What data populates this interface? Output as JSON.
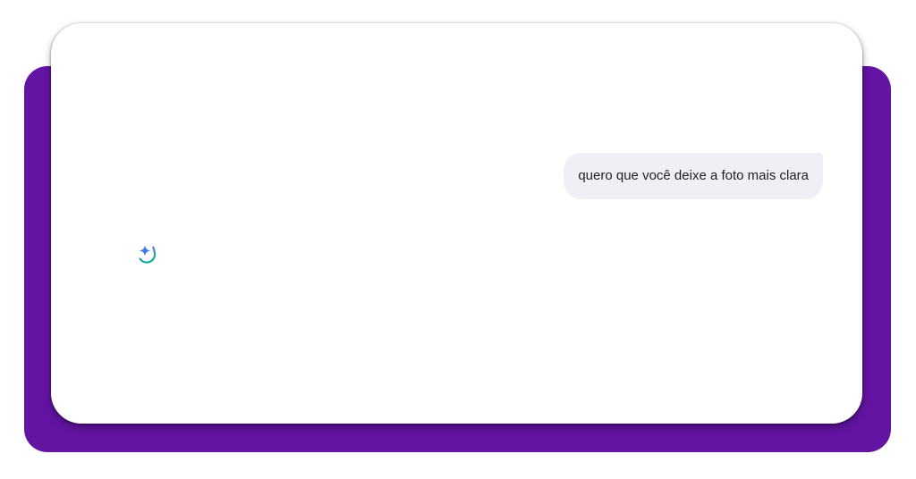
{
  "colors": {
    "backdrop": "#6314a3",
    "card": "#ffffff",
    "bubble": "#eef0f6",
    "bubble_text": "#1f1f1f",
    "spark_blue": "#3d7bf2",
    "spinner_teal": "#1ca89a",
    "spinner_blue": "#4285f4"
  },
  "chat": {
    "messages": [
      {
        "role": "user",
        "text": "quero que você deixe a foto mais clara"
      }
    ],
    "assistant": {
      "status_icon": "gemini-sparkle-loading-icon"
    }
  }
}
